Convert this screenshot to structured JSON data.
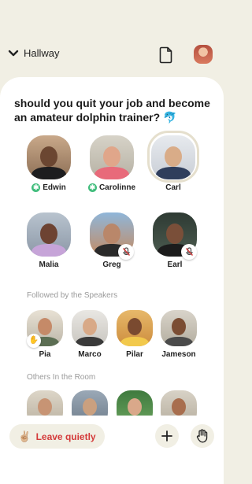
{
  "header": {
    "back_label": "Hallway",
    "back_icon": "chevron-down-icon",
    "doc_icon": "document-icon"
  },
  "room": {
    "title": "should you quit your job and become an amateur dolphin trainer?",
    "title_emoji": "🐬"
  },
  "speakers": [
    {
      "name": "Edwin",
      "moderator": true,
      "muted": false
    },
    {
      "name": "Carolinne",
      "moderator": true,
      "muted": false
    },
    {
      "name": "Carl",
      "moderator": false,
      "muted": false,
      "speaking": true
    },
    {
      "name": "Malia",
      "moderator": false,
      "muted": false
    },
    {
      "name": "Greg",
      "moderator": false,
      "muted": true
    },
    {
      "name": "Earl",
      "moderator": false,
      "muted": true
    }
  ],
  "followed": {
    "label": "Followed by the Speakers",
    "people": [
      {
        "name": "Pia",
        "hand_raised": true
      },
      {
        "name": "Marco"
      },
      {
        "name": "Pilar"
      },
      {
        "name": "Jameson"
      }
    ]
  },
  "others": {
    "label": "Others In the Room"
  },
  "bottom": {
    "leave_label": "Leave quietly",
    "leave_emoji": "✌🏼",
    "add_icon": "plus-icon",
    "hand_icon": "raise-hand-icon"
  },
  "colors": {
    "background": "#f1efe4",
    "leave_text": "#d43a3a",
    "moderator_badge": "#3fbc7b",
    "speaker_ring": "#e5dfcd"
  }
}
